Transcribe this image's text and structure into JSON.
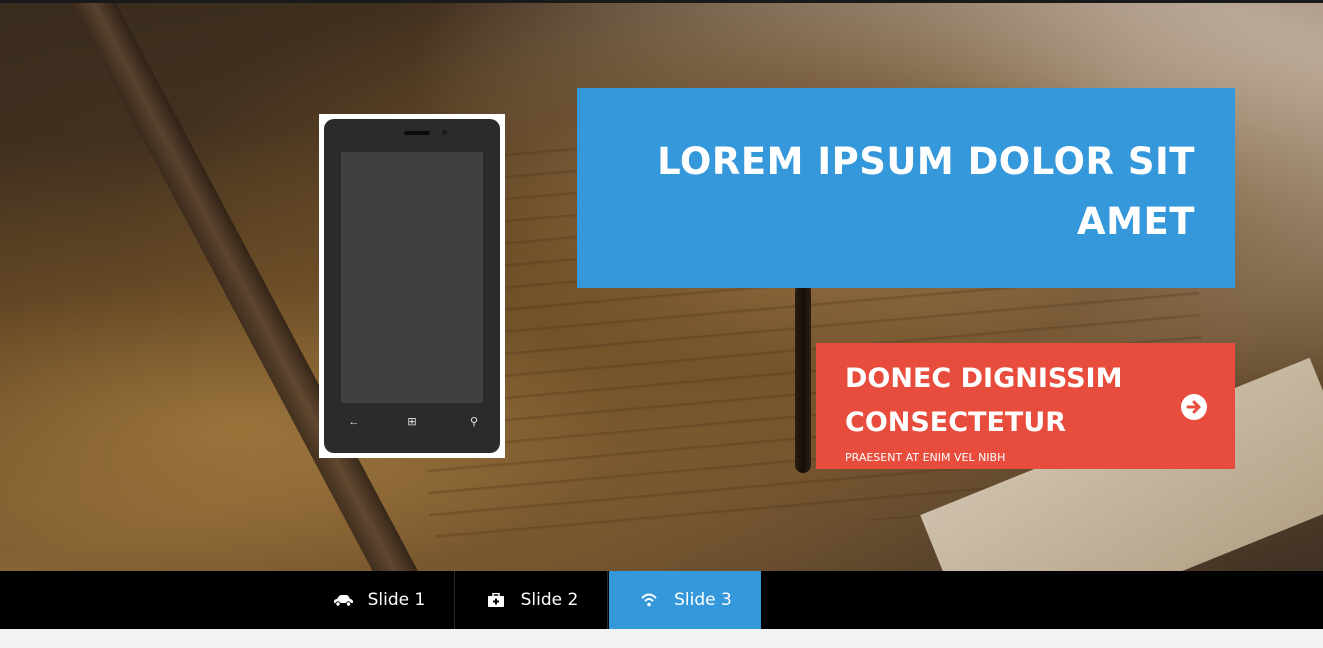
{
  "hero": {
    "title": "LOREM IPSUM DOLOR SIT AMET",
    "cta": {
      "title": "DONEC DIGNISSIM CONSECTETUR",
      "subtitle": "PRAESENT AT ENIM VEL NIBH",
      "icon": "arrow-circle-right-icon"
    },
    "phone_keys": {
      "back": "←",
      "home": "⊞",
      "search": "⚲"
    }
  },
  "nav": {
    "tabs": [
      {
        "label": "Slide 1",
        "icon": "car-icon",
        "active": false
      },
      {
        "label": "Slide 2",
        "icon": "medkit-icon",
        "active": false
      },
      {
        "label": "Slide 3",
        "icon": "wifi-icon",
        "active": true
      }
    ]
  },
  "colors": {
    "blue": "#3498db",
    "red": "#e74c3c",
    "nav_bg": "#000000"
  }
}
